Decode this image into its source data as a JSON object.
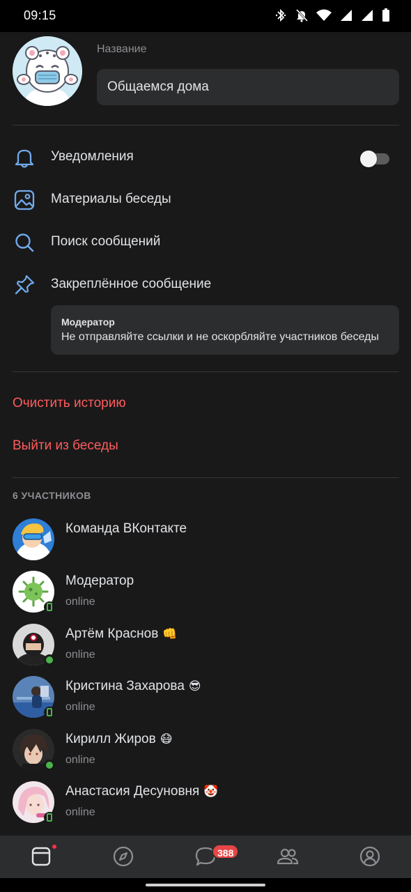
{
  "status_bar": {
    "time": "09:15",
    "icons": [
      "bluetooth-icon",
      "muted-bell-icon",
      "wifi-icon",
      "signal-icon",
      "signal-icon",
      "battery-icon"
    ]
  },
  "header": {
    "name_label": "Название",
    "name_value": "Общаемся дома"
  },
  "menu": {
    "notifications": {
      "label": "Уведомления",
      "icon": "bell-icon",
      "enabled": false
    },
    "materials": {
      "label": "Материалы беседы",
      "icon": "image-icon"
    },
    "search": {
      "label": "Поиск сообщений",
      "icon": "search-icon"
    },
    "pinned": {
      "label": "Закреплённое сообщение",
      "icon": "pin-icon"
    }
  },
  "pinned_message": {
    "author": "Модератор",
    "text": "Не отправляйте ссылки и не оскорбляйте участников беседы"
  },
  "actions": {
    "clear_history": "Очистить историю",
    "leave_chat": "Выйти из беседы"
  },
  "members": {
    "title": "6 УЧАСТНИКОВ",
    "list": [
      {
        "name": "Команда ВКонтакте",
        "emoji": "",
        "status": "",
        "indicator": "none"
      },
      {
        "name": "Модератор",
        "emoji": "",
        "status": "online",
        "indicator": "mobile"
      },
      {
        "name": "Артём Краснов",
        "emoji": "👊",
        "status": "online",
        "indicator": "dot"
      },
      {
        "name": "Кристина Захарова",
        "emoji": "😎",
        "status": "online",
        "indicator": "mobile"
      },
      {
        "name": "Кирилл Жиров",
        "emoji": "😷",
        "status": "online",
        "indicator": "dot"
      },
      {
        "name": "Анастасия Десуновня",
        "emoji": "🤡",
        "status": "online",
        "indicator": "mobile"
      }
    ]
  },
  "tabbar": {
    "tabs": [
      {
        "icon": "news-icon",
        "has_dot": true
      },
      {
        "icon": "compass-icon"
      },
      {
        "icon": "messages-icon",
        "badge": "388"
      },
      {
        "icon": "friends-icon"
      },
      {
        "icon": "profile-icon"
      }
    ]
  },
  "colors": {
    "background": "#19191a",
    "accent": "#71aaeb",
    "danger": "#ff5c5c",
    "online": "#4bb34b",
    "badge": "#e64646"
  }
}
